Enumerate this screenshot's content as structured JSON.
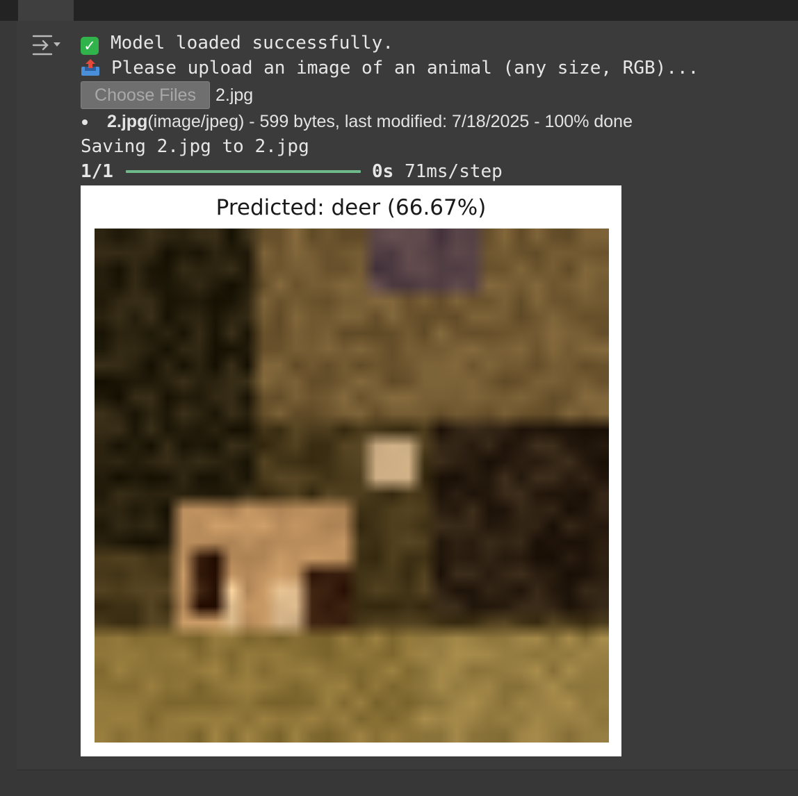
{
  "output": {
    "line1": "Model loaded successfully.",
    "line2": "Please upload an image of an animal (any size, RGB)...",
    "choose_button": "Choose Files",
    "selected_file": "2.jpg",
    "file_entry": {
      "name": "2.jpg",
      "details": "(image/jpeg) - 599 bytes, last modified: 7/18/2025 - 100% done"
    },
    "saving": "Saving 2.jpg to 2.jpg",
    "progress": {
      "steps": "1/1",
      "fraction": 1.0,
      "time": "0s",
      "rate": "71ms/step"
    }
  },
  "figure": {
    "title": "Predicted: deer (66.67%)"
  },
  "icons": {
    "toggle": "output-toggle-icon",
    "check": "check-mark-icon",
    "upload": "outbox-tray-icon"
  },
  "colors": {
    "check_green": "#2fb34a",
    "progress_green": "#6fba8a"
  }
}
